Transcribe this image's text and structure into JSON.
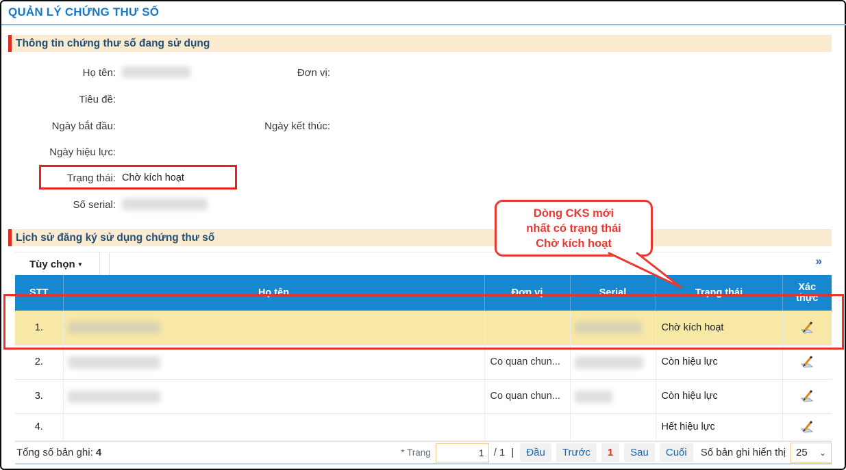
{
  "page": {
    "title": "QUẢN LÝ CHỨNG THƯ SỐ"
  },
  "info": {
    "title": "Thông tin chứng thư số đang sử dụng",
    "labels": {
      "ho_ten": "Họ tên:",
      "don_vi": "Đơn vị:",
      "tieu_de": "Tiêu đề:",
      "ngay_bat_dau": "Ngày bắt đầu:",
      "ngay_ket_thuc": "Ngày kết thúc:",
      "ngay_hieu_luc": "Ngày hiệu lực:",
      "trang_thai": "Trạng thái:",
      "so_serial": "Số serial:"
    },
    "values": {
      "trang_thai": "Chờ kích hoạt"
    }
  },
  "callout": {
    "lines": [
      "Dòng CKS mới",
      "nhất có trạng thái",
      "Chờ kích hoạt"
    ]
  },
  "history": {
    "title": "Lịch sử đăng ký sử dụng chứng thư số",
    "toolbar": {
      "options": "Tùy chọn"
    },
    "table": {
      "headers": [
        "STT",
        "Họ tên",
        "Đơn vị",
        "Serial",
        "Trạng thái",
        "Xác thực"
      ],
      "rows": [
        {
          "stt": "1.",
          "don_vi": "",
          "trang_thai": "Chờ kích hoạt"
        },
        {
          "stt": "2.",
          "don_vi": "Co quan chun...",
          "trang_thai": "Còn hiệu lực"
        },
        {
          "stt": "3.",
          "don_vi": "Co quan chun...",
          "trang_thai": "Còn hiệu lực"
        },
        {
          "stt": "4.",
          "don_vi": "",
          "trang_thai": "Hết hiệu lực"
        }
      ]
    },
    "footer": {
      "total_label": "Tổng số bản ghi:",
      "total_value": "4",
      "page_label": "* Trang",
      "page_value": "1",
      "page_of": "/ 1",
      "separator": "|",
      "nav": {
        "first": "Đầu",
        "prev": "Trước",
        "current": "1",
        "next": "Sau",
        "last": "Cuối"
      },
      "size_label": "Số bản ghi hiển thị",
      "size_value": "25"
    }
  },
  "icons": {
    "caret_down": "▾",
    "double_chevron": "»",
    "select_chevron": "⌄"
  },
  "colors": {
    "title_blue": "#1878C8",
    "header_blue": "#1787D0",
    "highlight_yellow": "#F8E8A6",
    "accent_red": "#E8322A",
    "link_blue": "#1266B3",
    "section_cream": "#FBEBD0"
  }
}
